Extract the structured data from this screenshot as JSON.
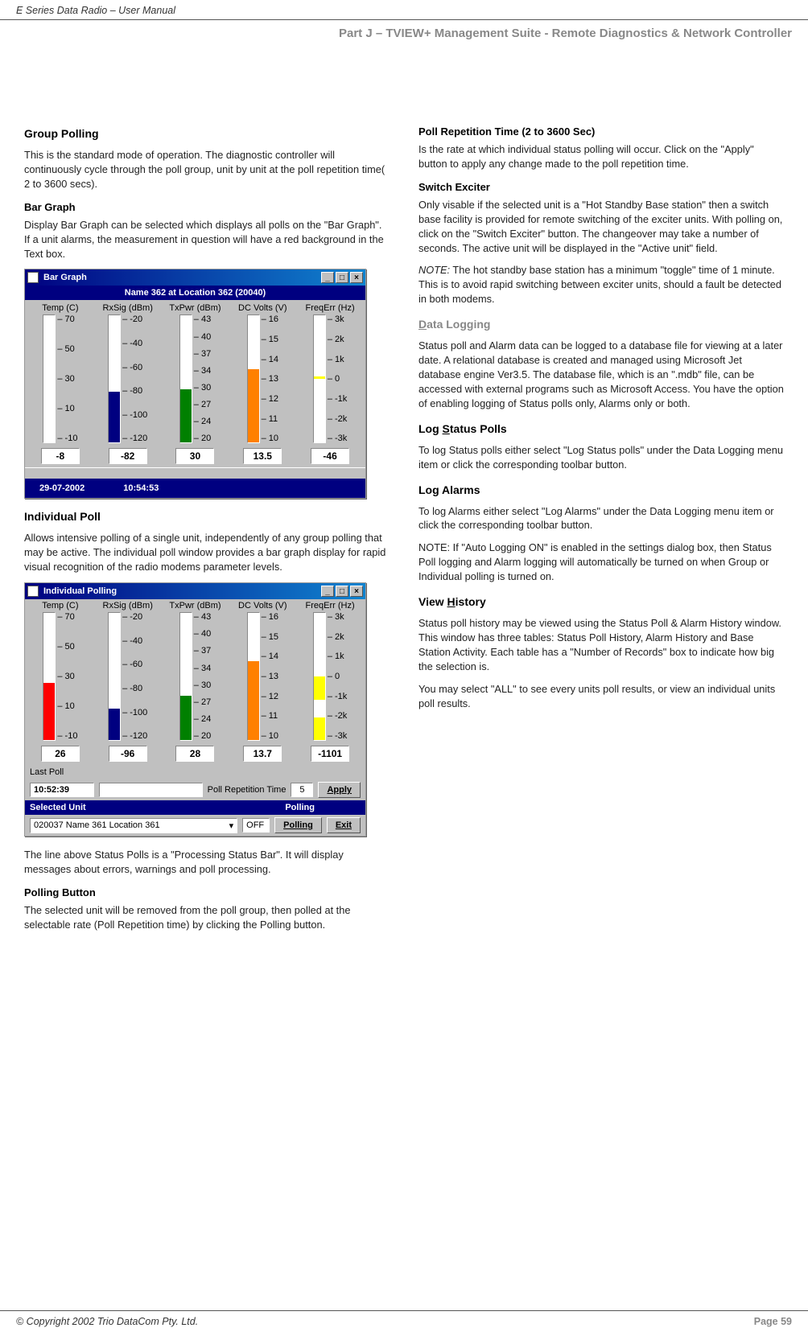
{
  "header": {
    "doc_title": "E Series Data Radio – User Manual",
    "part_title": "Part J – TVIEW+ Management Suite -  Remote Diagnostics & Network Controller"
  },
  "left": {
    "group_polling": {
      "title": "Group Polling",
      "text": "This is the standard mode of operation.  The diagnostic controller will continuously cycle through the poll group, unit by unit at the poll repetition time( 2 to 3600 secs)."
    },
    "bar_graph": {
      "title": "Bar Graph",
      "text": "Display Bar Graph can be selected which displays all polls on the \"Bar Graph\".  If a unit alarms, the measurement in question will have a red background in the Text box."
    },
    "indiv": {
      "title": "Individual Poll",
      "text": "Allows intensive polling of a single unit, independently of any group polling that may be active.  The individual poll window provides a bar graph display for rapid visual recognition of the radio modems parameter levels."
    },
    "psb_text": "The line above Status Polls is a \"Processing Status Bar\".  It will display messages about errors, warnings and poll processing.",
    "polling_button": {
      "title": "Polling Button",
      "text": "The selected unit will be removed from the poll group, then polled at the selectable rate (Poll Repetition time) by clicking the Polling button."
    }
  },
  "right": {
    "prt": {
      "title": "Poll Repetition Time (2 to 3600 Sec)",
      "text": "Is the rate at which individual status polling will occur.  Click on the \"Apply\" button to apply any change made to the poll repetition time."
    },
    "se": {
      "title": "Switch Exciter",
      "text": "Only visable if the selected unit is a \"Hot Standby Base station\" then a switch base facility is provided for remote switching of the exciter units.  With polling on, click on the \"Switch Exciter\" button.  The changeover may take a number of seconds.  The active unit will be displayed in the \"Active unit\" field.",
      "note_label": "NOTE:",
      "note_text": " The hot standby base station has a minimum \"toggle\" time of 1 minute.  This is to avoid rapid switching between exciter units, should a fault be detected in both modems."
    },
    "dl": {
      "title_pre": "D",
      "title_post": "ata Logging",
      "text": "Status poll and Alarm data can be logged to a database file for viewing at a later date.  A relational database is created and managed using Microsoft Jet database engine Ver3.5.  The database file, which is an \".mdb\" file, can be accessed with external programs such as Microsoft Access.  You have the option of enabling logging of Status polls only, Alarms only or both."
    },
    "lsp": {
      "title_pre": "Log ",
      "title_u": "S",
      "title_post": "tatus Polls",
      "text": "To log Status polls either select \"Log Status polls\" under the Data Logging menu item or click the corresponding toolbar button."
    },
    "la": {
      "title": "Log Alarms",
      "text": "To log Alarms either select \"Log Alarms\" under the Data Logging menu item or click the corresponding toolbar button.",
      "note": "NOTE: If \"Auto Logging ON\" is enabled in the settings dialog box, then Status Poll logging and Alarm logging will automatically be turned on when Group or Individual polling is turned on."
    },
    "vh": {
      "title_pre": "View ",
      "title_u": "H",
      "title_post": "istory",
      "text1": "Status poll history may be viewed using the Status Poll & Alarm History window.  This window has three tables: Status Poll History, Alarm History and Base Station Activity.  Each table has a \"Number of Records\" box to indicate how big the selection is.",
      "text2": "You may select \"ALL\" to see every units poll results, or view an individual units poll results."
    }
  },
  "chart_data": [
    {
      "window_title": "Bar Graph",
      "header": "Name 362 at Location 362 (20040)",
      "date": "29-07-2002",
      "time": "10:54:53",
      "gauges": [
        {
          "label": "Temp (C)",
          "ticks": [
            "70",
            "50",
            "30",
            "10",
            "-10"
          ],
          "value": "-8",
          "fill_color": "#fff",
          "fill_pct": 0,
          "ylim": [
            -10,
            70
          ]
        },
        {
          "label": "RxSig (dBm)",
          "ticks": [
            "-20",
            "-40",
            "-60",
            "-80",
            "-100",
            "-120"
          ],
          "value": "-82",
          "fill_color": "#000080",
          "fill_pct": 40,
          "ylim": [
            -120,
            -20
          ]
        },
        {
          "label": "TxPwr (dBm)",
          "ticks": [
            "43",
            "40",
            "37",
            "34",
            "30",
            "27",
            "24",
            "20"
          ],
          "value": "30",
          "fill_color": "#008000",
          "fill_pct": 42,
          "ylim": [
            20,
            43
          ]
        },
        {
          "label": "DC Volts (V)",
          "ticks": [
            "16",
            "15",
            "14",
            "13",
            "12",
            "11",
            "10"
          ],
          "value": "13.5",
          "fill_color": "#ff8000",
          "fill_pct": 58,
          "ylim": [
            10,
            16
          ]
        },
        {
          "label": "FreqErr (Hz)",
          "ticks": [
            "3k",
            "2k",
            "1k",
            "0",
            "-1k",
            "-2k",
            "-3k"
          ],
          "value": "-46",
          "fill_color": "#fff",
          "fill_pct": 0,
          "yellow_pct": 50,
          "ylim": [
            -3000,
            3000
          ]
        }
      ]
    },
    {
      "window_title": "Individual Polling",
      "gauges": [
        {
          "label": "Temp (C)",
          "ticks": [
            "70",
            "50",
            "30",
            "10",
            "-10"
          ],
          "value": "26",
          "fill_color": "#ff0000",
          "fill_pct": 45,
          "ylim": [
            -10,
            70
          ]
        },
        {
          "label": "RxSig (dBm)",
          "ticks": [
            "-20",
            "-40",
            "-60",
            "-80",
            "-100",
            "-120"
          ],
          "value": "-96",
          "fill_color": "#000080",
          "fill_pct": 25,
          "ylim": [
            -120,
            -20
          ]
        },
        {
          "label": "TxPwr (dBm)",
          "ticks": [
            "43",
            "40",
            "37",
            "34",
            "30",
            "27",
            "24",
            "20"
          ],
          "value": "28",
          "fill_color": "#008000",
          "fill_pct": 35,
          "ylim": [
            20,
            43
          ]
        },
        {
          "label": "DC Volts (V)",
          "ticks": [
            "16",
            "15",
            "14",
            "13",
            "12",
            "11",
            "10"
          ],
          "value": "13.7",
          "fill_color": "#ff8000",
          "fill_pct": 62,
          "ylim": [
            10,
            16
          ]
        },
        {
          "label": "FreqErr (Hz)",
          "ticks": [
            "3k",
            "2k",
            "1k",
            "0",
            "-1k",
            "-2k",
            "-3k"
          ],
          "value": "-1101",
          "fill_color": "#ffff00",
          "fill_pct": 18,
          "yellow_pos": 32,
          "ylim": [
            -3000,
            3000
          ]
        }
      ],
      "last_poll_label": "Last Poll",
      "last_poll": "10:52:39",
      "rep_label": "Poll Repetition Time",
      "rep_value": "5",
      "apply": "Apply",
      "sel_label": "Selected Unit",
      "sel_value": "020037 Name 361 Location 361",
      "polling_label": "Polling",
      "polling_state": "OFF",
      "polling_btn": "Polling",
      "exit_btn": "Exit"
    }
  ],
  "footer": {
    "copyright": "© Copyright 2002 Trio DataCom Pty. Ltd.",
    "page": "Page 59"
  }
}
